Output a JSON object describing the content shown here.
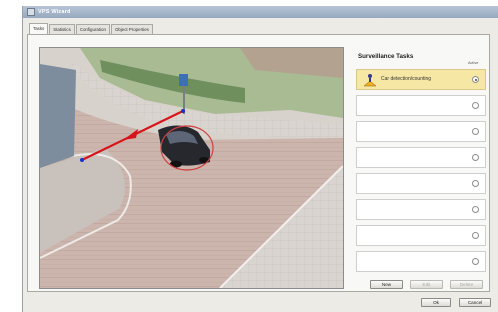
{
  "window": {
    "title": "VPS Wizard"
  },
  "tabs": [
    {
      "label": "Tasks",
      "active": true
    },
    {
      "label": "Statistics",
      "active": false
    },
    {
      "label": "Configuration",
      "active": false
    },
    {
      "label": "Object Properties",
      "active": false
    }
  ],
  "tasks_panel": {
    "heading": "Surveillance Tasks",
    "active_column_label": "Active",
    "rows": [
      {
        "label": "Car detection/counting",
        "icon": "person-warning-icon",
        "selected": true
      },
      {
        "label": "",
        "selected": false
      },
      {
        "label": "",
        "selected": false
      },
      {
        "label": "",
        "selected": false
      },
      {
        "label": "",
        "selected": false
      },
      {
        "label": "",
        "selected": false
      },
      {
        "label": "",
        "selected": false
      },
      {
        "label": "",
        "selected": false
      }
    ],
    "buttons": {
      "new": "New",
      "edit": "Edit",
      "delete": "Delete"
    }
  },
  "dialog_buttons": {
    "ok": "Ok",
    "cancel": "Cancel"
  },
  "colors": {
    "selected_row": "#f6e8a4",
    "tripwire_line": "#d8141b",
    "tripwire_endpoint": "#1833c8",
    "object_outline": "#d04040"
  }
}
